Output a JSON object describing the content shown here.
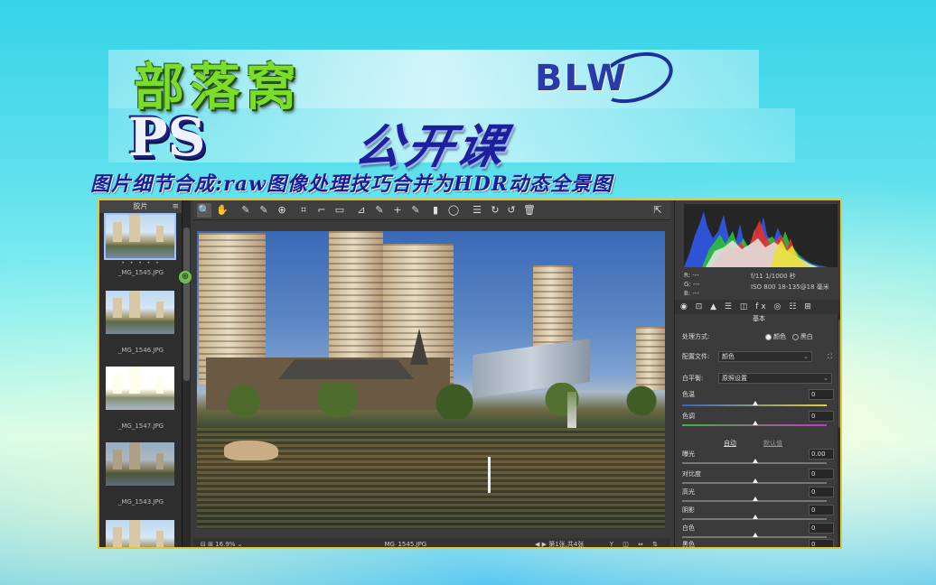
{
  "banner": {
    "title_main": "部落窝",
    "logo": "BLW",
    "title_ps": "PS",
    "title_course": "公开课",
    "subtitle": "图片细节合成:raw图像处理技巧合并为HDR动态全景图"
  },
  "filmstrip": {
    "header": "胶片",
    "menu_icon": "≡",
    "items": [
      {
        "label": "_MG_1545.JPG",
        "selected": true,
        "dots": "• • • • •"
      },
      {
        "label": "_MG_1546.JPG",
        "selected": false
      },
      {
        "label": "_MG_1547.JPG",
        "selected": false
      },
      {
        "label": "_MG_1543.JPG",
        "selected": false
      }
    ]
  },
  "toolbar": {
    "tools": [
      "🔍",
      "✋",
      "✎",
      "✎",
      "⊕",
      "⌗",
      "⌐",
      "▭",
      "⊿",
      "✎",
      "+",
      "✎",
      "▮",
      "◯",
      "☰",
      "↻",
      "↺",
      "🗑"
    ],
    "export_icon": "⇱"
  },
  "statusbar": {
    "zoom": "⊟ ⊞   16.9%  ⌄",
    "filename": "_MG_1545.JPG",
    "nav": "◀ ▶   第1张,共4张",
    "icons": "Y ◫ ⇔ ⇅"
  },
  "right_panel": {
    "cam_rgb": [
      "R:  ---",
      "G:  ---",
      "B:  ---"
    ],
    "cam_exposure": [
      "f/11    1/1000 秒",
      "ISO 800   18-135@18 毫米"
    ],
    "tab_icons": "◉ ⊡ ▲ ☰ ◫ fx ◎ ☷ ⊞",
    "panel_title": "基本",
    "treatment_label": "处理方式:",
    "treatment_color": "颜色",
    "treatment_bw": "黑白",
    "profile_label": "配置文件:",
    "profile_value": "颜色",
    "wb_label": "白平衡:",
    "wb_value": "原照设置",
    "temp_label": "色温",
    "temp_value": "0",
    "tint_label": "色调",
    "tint_value": "0",
    "auto_label": "自动",
    "default_label": "默认值",
    "exposure_label": "曝光",
    "exposure_value": "0.00",
    "contrast_label": "对比度",
    "contrast_value": "0",
    "highlights_label": "高光",
    "highlights_value": "0",
    "shadows_label": "阴影",
    "shadows_value": "0",
    "whites_label": "白色",
    "whites_value": "0",
    "blacks_label": "黑色",
    "blacks_value": "0"
  }
}
